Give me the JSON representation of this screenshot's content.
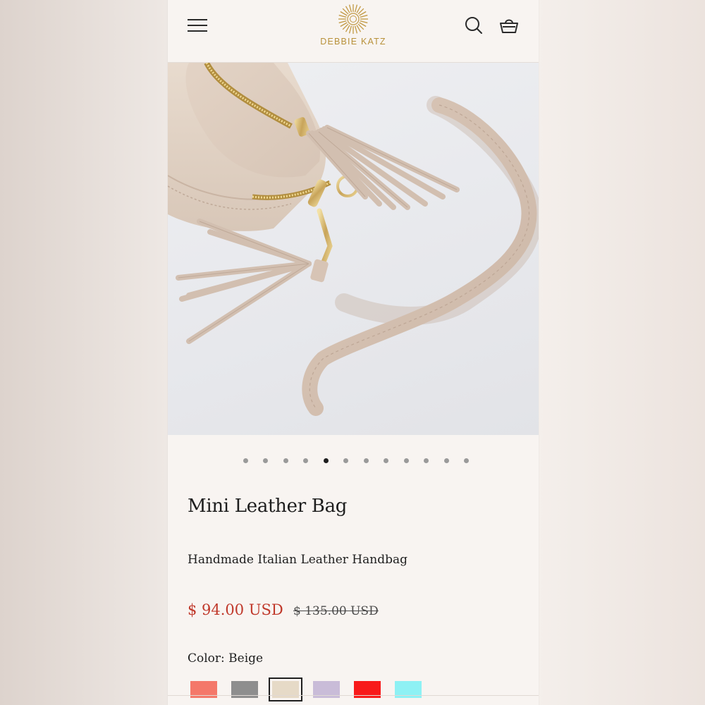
{
  "brand": {
    "name": "DEBBIE KATZ",
    "accent_color": "#b8913a"
  },
  "header": {
    "menu_icon": "hamburger-menu-icon",
    "search_icon": "search-icon",
    "cart_icon": "shopping-basket-icon"
  },
  "gallery": {
    "image_subject": "beige leather crossbody bag with tassel",
    "dot_count": 12,
    "active_index": 4
  },
  "product": {
    "title": "Mini Leather Bag",
    "subtitle": "Handmade Italian Leather Handbag",
    "price": "$ 94.00 USD",
    "compare_price": "$ 135.00 USD",
    "price_color": "#c0392b",
    "color_label": "Color: Beige",
    "swatches": [
      {
        "name": "coral",
        "color": "#f4786a",
        "selected": false
      },
      {
        "name": "gray",
        "color": "#8e8e8e",
        "selected": false
      },
      {
        "name": "beige",
        "color": "#e6dac7",
        "selected": true
      },
      {
        "name": "lavender",
        "color": "#c9bcd8",
        "selected": false
      },
      {
        "name": "red",
        "color": "#f81a1a",
        "selected": false
      },
      {
        "name": "aqua",
        "color": "#8ef1f4",
        "selected": false
      }
    ]
  }
}
